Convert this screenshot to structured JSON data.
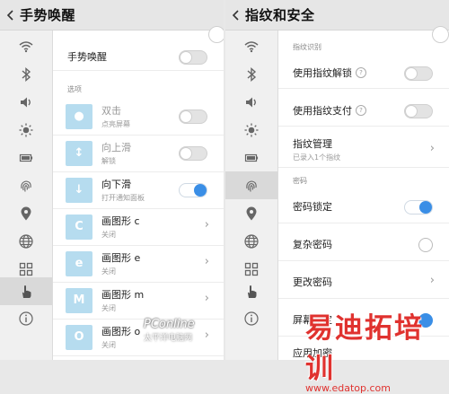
{
  "left": {
    "title": "手势唤醒",
    "main_toggle_label": "手势唤醒",
    "section_options": "选项",
    "options": [
      {
        "title": "双击",
        "sub": "点亮屏幕",
        "control": "toggle",
        "on": false,
        "glyph": "dot"
      },
      {
        "title": "向上滑",
        "sub": "解锁",
        "control": "toggle",
        "on": false,
        "glyph": "up"
      },
      {
        "title": "向下滑",
        "sub": "打开通知面板",
        "control": "toggle",
        "on": true,
        "glyph": "down"
      },
      {
        "title": "画图形 c",
        "sub": "关闭",
        "control": "chevron",
        "glyph": "C"
      },
      {
        "title": "画图形 e",
        "sub": "关闭",
        "control": "chevron",
        "glyph": "e"
      },
      {
        "title": "画图形 m",
        "sub": "关闭",
        "control": "chevron",
        "glyph": "M"
      },
      {
        "title": "画图形 o",
        "sub": "关闭",
        "control": "chevron",
        "glyph": "O"
      }
    ]
  },
  "right": {
    "title": "指纹和安全",
    "section_fingerprint": "指纹识别",
    "use_unlock": "使用指纹解锁",
    "use_pay": "使用指纹支付",
    "fp_manage": "指纹管理",
    "fp_manage_sub": "已录入1个指纹",
    "section_password": "密码",
    "pwd_lock": "密码锁定",
    "complex_pwd": "复杂密码",
    "change_pwd": "更改密码",
    "screen_lock": "屏幕锁定",
    "app_lock": "应用加密"
  },
  "sidebar_icons": [
    "wifi-icon",
    "bluetooth-icon",
    "volume-icon",
    "brightness-icon",
    "battery-icon",
    "fingerprint-icon",
    "location-icon",
    "globe-icon",
    "apps-grid-icon",
    "gesture-hand-icon",
    "info-icon"
  ],
  "watermark": {
    "left_brand": "PConline",
    "left_sub": "太平洋电脑网",
    "right_brand": "易迪拓培训",
    "right_url": "www.edatop.com"
  },
  "colors": {
    "accent": "#3a8ee6",
    "thumb": "#b6dcef",
    "watermark_red": "#e0322f"
  }
}
